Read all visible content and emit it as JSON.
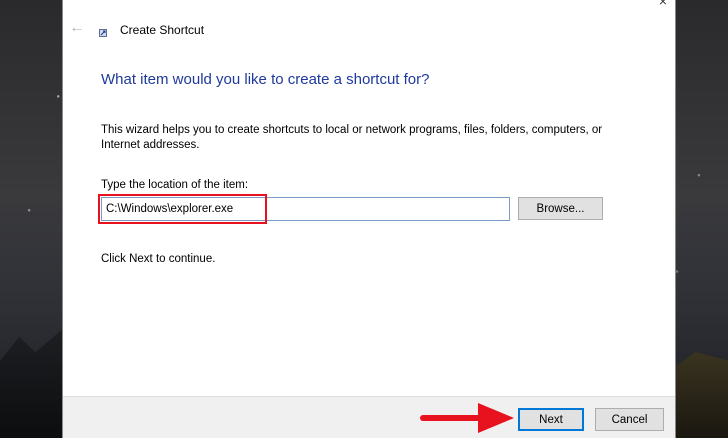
{
  "window": {
    "title": "Create Shortcut",
    "close_glyph": "×"
  },
  "page": {
    "heading": "What item would you like to create a shortcut for?",
    "description": "This wizard helps you to create shortcuts to local or network programs, files, folders, computers, or Internet addresses.",
    "location_label": "Type the location of the item:",
    "location_value": "C:\\Windows\\explorer.exe",
    "browse_label": "Browse...",
    "continue_text": "Click Next to continue."
  },
  "footer": {
    "next_label": "Next",
    "cancel_label": "Cancel"
  },
  "icons": {
    "back": "back-arrow-icon",
    "app": "shortcut-icon",
    "close": "close-icon",
    "annotation": "red-arrow-icon"
  },
  "colors": {
    "heading": "#1f3a9c",
    "highlight": "#e8111e",
    "next_border": "#0078d7",
    "dialog_bg": "#ffffff",
    "footer_bg": "#f0f0f0"
  }
}
